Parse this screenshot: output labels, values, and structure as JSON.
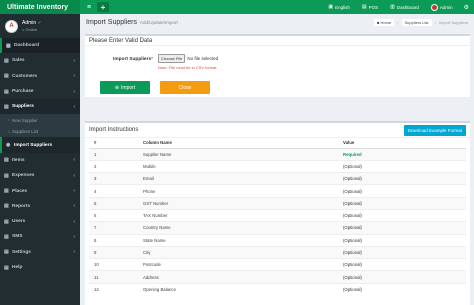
{
  "app": {
    "title": "Ultimate Inventory"
  },
  "topbar": {
    "menu_icon": "≡",
    "add_icon": "+",
    "links": [
      {
        "icon": "▣",
        "label": "English"
      },
      {
        "icon": "▤",
        "label": "POS"
      },
      {
        "icon": "▥",
        "label": "Dashboard"
      },
      {
        "icon": "",
        "label": "Admin"
      }
    ],
    "settings_icon": "⚙"
  },
  "user": {
    "name": "Admin",
    "verified": "✔",
    "status": "Online",
    "status_dot": "●",
    "avatar_letter": "A"
  },
  "sidebar": {
    "items": [
      {
        "icon": "▦",
        "label": "Dashboard",
        "chevron": ""
      },
      {
        "icon": "▤",
        "label": "Sales",
        "chevron": "‹"
      },
      {
        "icon": "▤",
        "label": "Customers",
        "chevron": "‹"
      },
      {
        "icon": "▤",
        "label": "Purchase",
        "chevron": "‹"
      },
      {
        "icon": "▤",
        "label": "Suppliers",
        "chevron": "‹"
      }
    ],
    "subitems": [
      {
        "icon": "○",
        "label": "New Supplier"
      },
      {
        "icon": "○",
        "label": "Suppliers List"
      }
    ],
    "current": {
      "icon": "◉",
      "label": "Import Suppliers"
    },
    "items2": [
      {
        "icon": "▤",
        "label": "Items",
        "chevron": "‹"
      },
      {
        "icon": "▤",
        "label": "Expenses",
        "chevron": "‹"
      },
      {
        "icon": "▤",
        "label": "Places",
        "chevron": "‹"
      },
      {
        "icon": "▤",
        "label": "Reports",
        "chevron": "‹"
      },
      {
        "icon": "▤",
        "label": "Users",
        "chevron": "‹"
      },
      {
        "icon": "▤",
        "label": "SMS",
        "chevron": "‹"
      },
      {
        "icon": "▤",
        "label": "Settings",
        "chevron": "‹"
      },
      {
        "icon": "▤",
        "label": "Help",
        "chevron": ""
      }
    ]
  },
  "header": {
    "title": "Import Suppliers",
    "subtitle": "Add/Update/Import",
    "breadcrumb": [
      {
        "icon": "■",
        "label": "Home"
      },
      {
        "icon": "",
        "label": "Suppliers List"
      },
      {
        "icon": "",
        "label": "Import Suppliers"
      }
    ],
    "sep": "›"
  },
  "form": {
    "title": "Please Enter Valid Data",
    "label": "Import Suppliers",
    "required": "*",
    "choose_file": "Choose File",
    "no_file": "No file selected",
    "note": "Note: File must be in CSV format",
    "import_label": "Import",
    "import_icon": "⊕",
    "close_label": "Close"
  },
  "instructions": {
    "title": "Import Instructions",
    "download_label": "Download Example Format",
    "headers": [
      "#",
      "Column Name",
      "Value"
    ],
    "rows": [
      {
        "n": "1",
        "name": "Supplier Name",
        "value": "Required"
      },
      {
        "n": "2",
        "name": "Mobile",
        "value": "(Optional)"
      },
      {
        "n": "3",
        "name": "Email",
        "value": "(Optional)"
      },
      {
        "n": "4",
        "name": "Phone",
        "value": "(Optional)"
      },
      {
        "n": "5",
        "name": "GST Number",
        "value": "(Optional)"
      },
      {
        "n": "6",
        "name": "TAX Number",
        "value": "(Optional)"
      },
      {
        "n": "7",
        "name": "Country Name",
        "value": "(Optional)"
      },
      {
        "n": "8",
        "name": "State Name",
        "value": "(Optional)"
      },
      {
        "n": "9",
        "name": "City",
        "value": "(Optional)"
      },
      {
        "n": "10",
        "name": "Postcode",
        "value": "(Optional)"
      },
      {
        "n": "11",
        "name": "Address",
        "value": "(Optional)"
      },
      {
        "n": "12",
        "name": "Opening Balance",
        "value": "(Optional)"
      }
    ]
  },
  "colors": {
    "accent": "#0b9a58",
    "sidebar": "#222d32",
    "warning": "#f39c12",
    "info": "#00a7d0"
  }
}
